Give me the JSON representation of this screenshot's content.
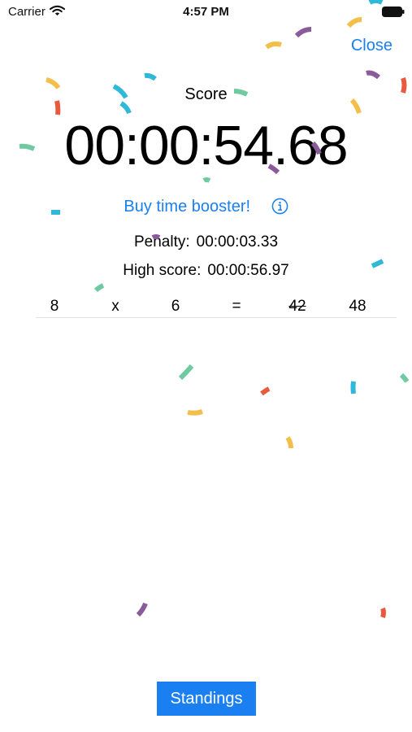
{
  "status_bar": {
    "carrier": "Carrier",
    "time": "4:57 PM"
  },
  "header": {
    "close_label": "Close"
  },
  "score": {
    "label": "Score",
    "value": "00:00:54.68"
  },
  "booster": {
    "label": "Buy time booster!"
  },
  "penalty": {
    "label": "Penalty:",
    "value": "00:00:03.33"
  },
  "high_score": {
    "label": "High score:",
    "value": "00:00:56.97"
  },
  "equation": {
    "operand_a": "8",
    "operator": "x",
    "operand_b": "6",
    "equals": "=",
    "wrong_answer": "42",
    "correct_answer": "48"
  },
  "footer": {
    "standings_label": "Standings"
  },
  "colors": {
    "accent": "#1a7ff1",
    "confetti": [
      "#f3bf4a",
      "#2fb8d8",
      "#e85a3e",
      "#8b5a9a",
      "#6fcaa1"
    ]
  }
}
